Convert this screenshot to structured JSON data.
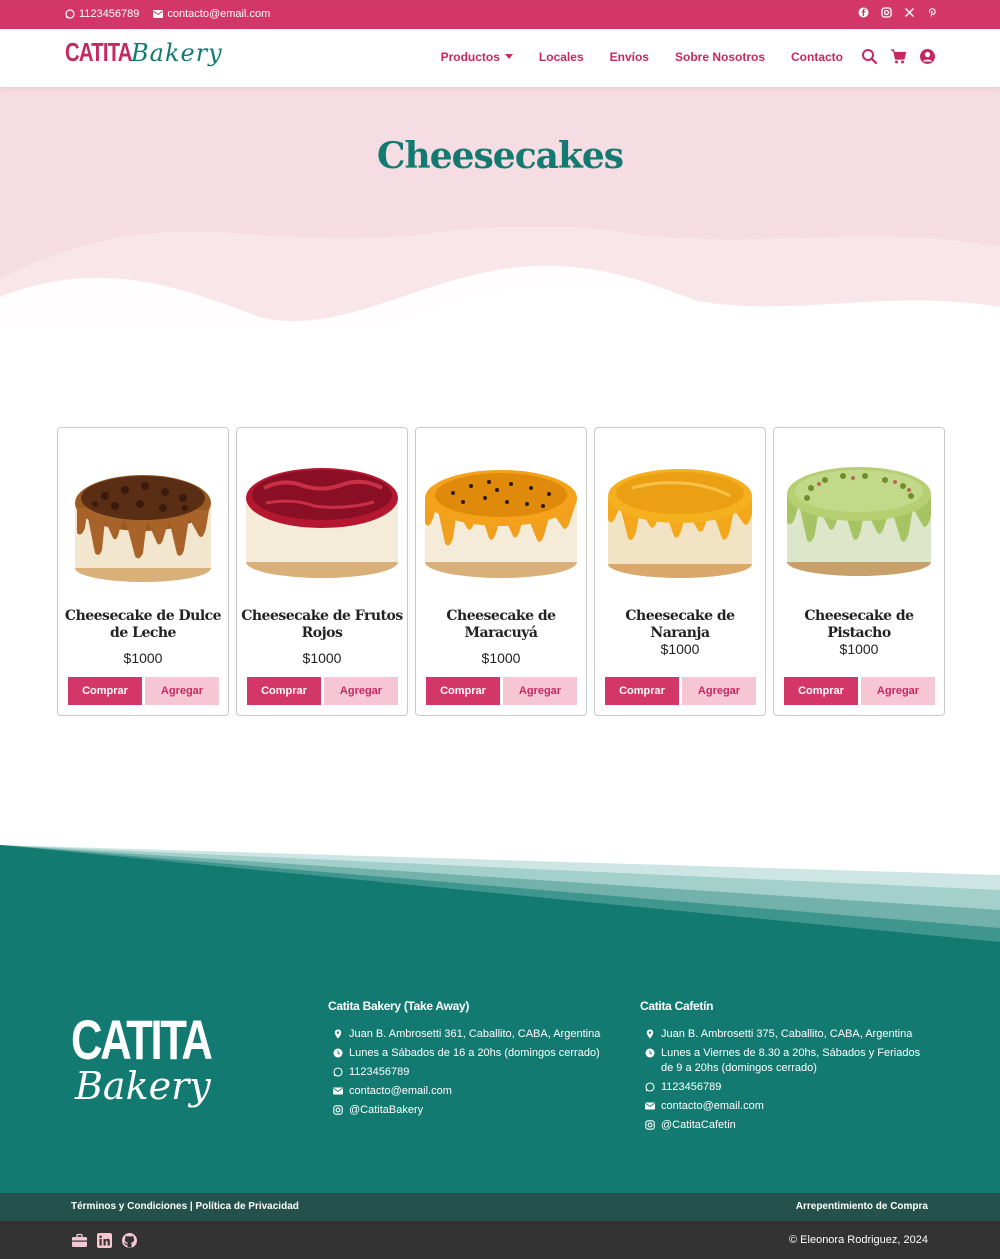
{
  "topbar": {
    "phone": "1123456789",
    "email": "contacto@email.com",
    "social_icons": [
      "facebook-icon",
      "instagram-icon",
      "x-icon",
      "pinterest-icon"
    ]
  },
  "brand": {
    "logo_main": "CATITA",
    "logo_script": "Bakery"
  },
  "nav": {
    "items": [
      "Productos",
      "Locales",
      "Envíos",
      "Sobre Nosotros",
      "Contacto"
    ],
    "icons": [
      "search-icon",
      "cart-icon",
      "user-icon"
    ]
  },
  "hero": {
    "title": "Cheesecakes"
  },
  "products": [
    {
      "name": "Cheesecake de Dulce de Leche",
      "price": "$1000",
      "buy": "Comprar",
      "add": "Agregar"
    },
    {
      "name": "Cheesecake de Frutos Rojos",
      "price": "$1000",
      "buy": "Comprar",
      "add": "Agregar"
    },
    {
      "name": "Cheesecake de Maracuyá",
      "price": "$1000",
      "buy": "Comprar",
      "add": "Agregar"
    },
    {
      "name": "Cheesecake de Naranja",
      "price": "$1000",
      "buy": "Comprar",
      "add": "Agregar"
    },
    {
      "name": "Cheesecake de Pistacho",
      "price": "$1000",
      "buy": "Comprar",
      "add": "Agregar"
    }
  ],
  "footer": {
    "logo_main": "CATITA",
    "logo_script": "Bakery",
    "col1": {
      "title": "Catita Bakery (Take Away)",
      "address": "Juan B. Ambrosetti 361, Caballito, CABA, Argentina",
      "hours": "Lunes a Sábados de 16 a 20hs (domingos cerrado)",
      "phone": "1123456789",
      "email": "contacto@email.com",
      "instagram": "@CatitaBakery"
    },
    "col2": {
      "title": "Catita Cafetín",
      "address": "Juan B. Ambrosetti 375, Caballito, CABA, Argentina",
      "hours": "Lunes a Viernes de 8.30 a 20hs, Sábados y Feriados de 9 a 20hs (domingos cerrado)",
      "phone": "1123456789",
      "email": "contacto@email.com",
      "instagram": "@CatitaCafetin"
    },
    "legal": "Términos y Condiciones | Política de Privacidad",
    "withdrawal": "Arrepentimiento de Compra",
    "copyright": "© Eleonora Rodriguez, 2024",
    "bottom_icons": [
      "briefcase-icon",
      "linkedin-icon",
      "github-icon"
    ]
  },
  "colors": {
    "brand_pink": "#d3376a",
    "brand_teal": "#137a72",
    "hero_bg": "#f6dce3"
  }
}
